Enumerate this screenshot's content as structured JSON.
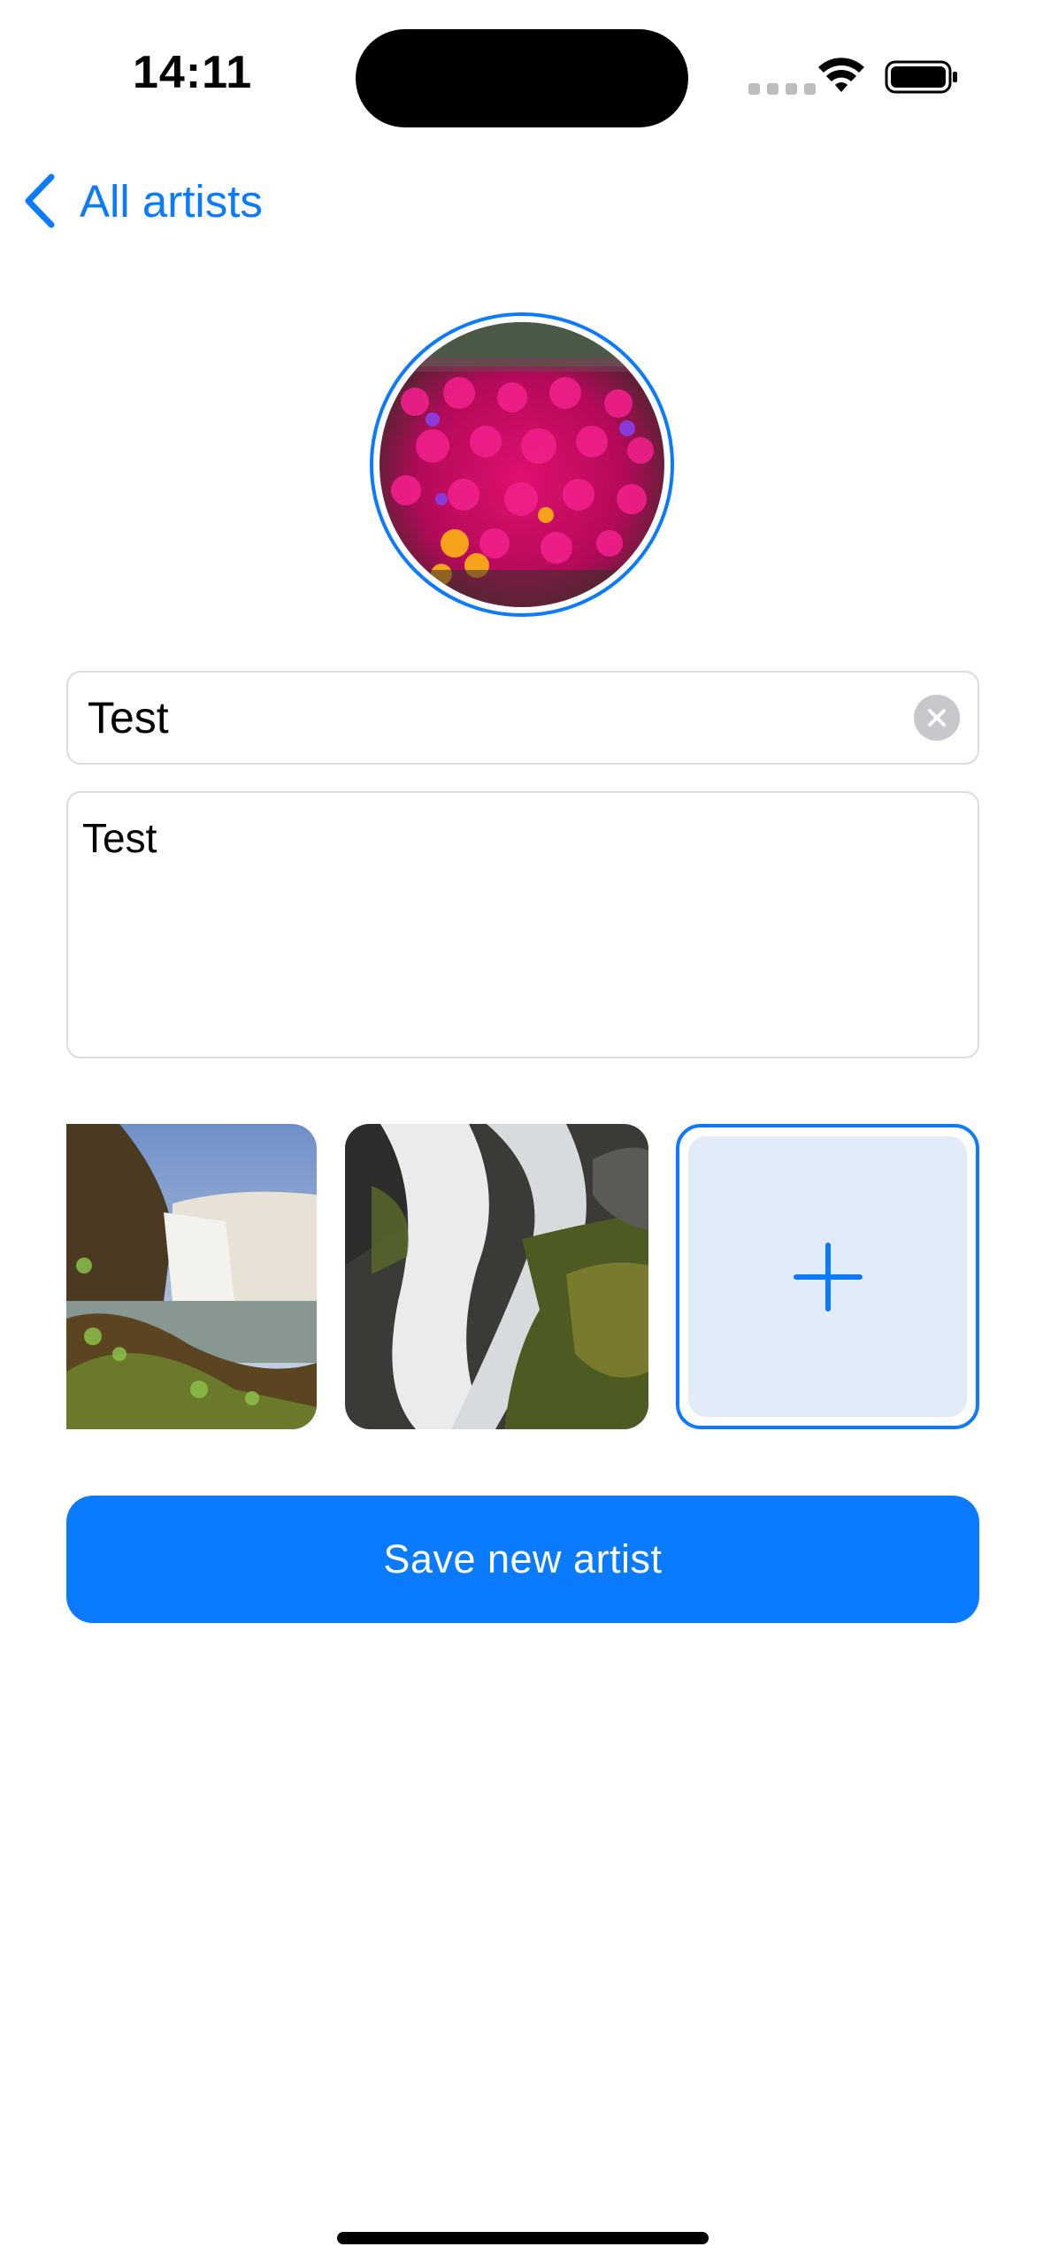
{
  "status_bar": {
    "time": "14:11",
    "icons": [
      "cellular-signal-icon",
      "wifi-icon",
      "battery-icon"
    ]
  },
  "navigation": {
    "back_label": "All artists",
    "back_icon": "chevron-left-icon"
  },
  "avatar": {
    "description": "flower-field-photo"
  },
  "form": {
    "name_value": "Test",
    "clear_icon": "clear-x-icon",
    "description_value": "Test"
  },
  "gallery": {
    "photos": [
      "waterfall-photo",
      "cascade-photo"
    ],
    "add_icon": "plus-icon"
  },
  "actions": {
    "save_label": "Save new artist"
  },
  "colors": {
    "accent": "#0A7AFF",
    "add_tile_bg": "#E1ECF8",
    "field_border": "#dcdcdc"
  }
}
